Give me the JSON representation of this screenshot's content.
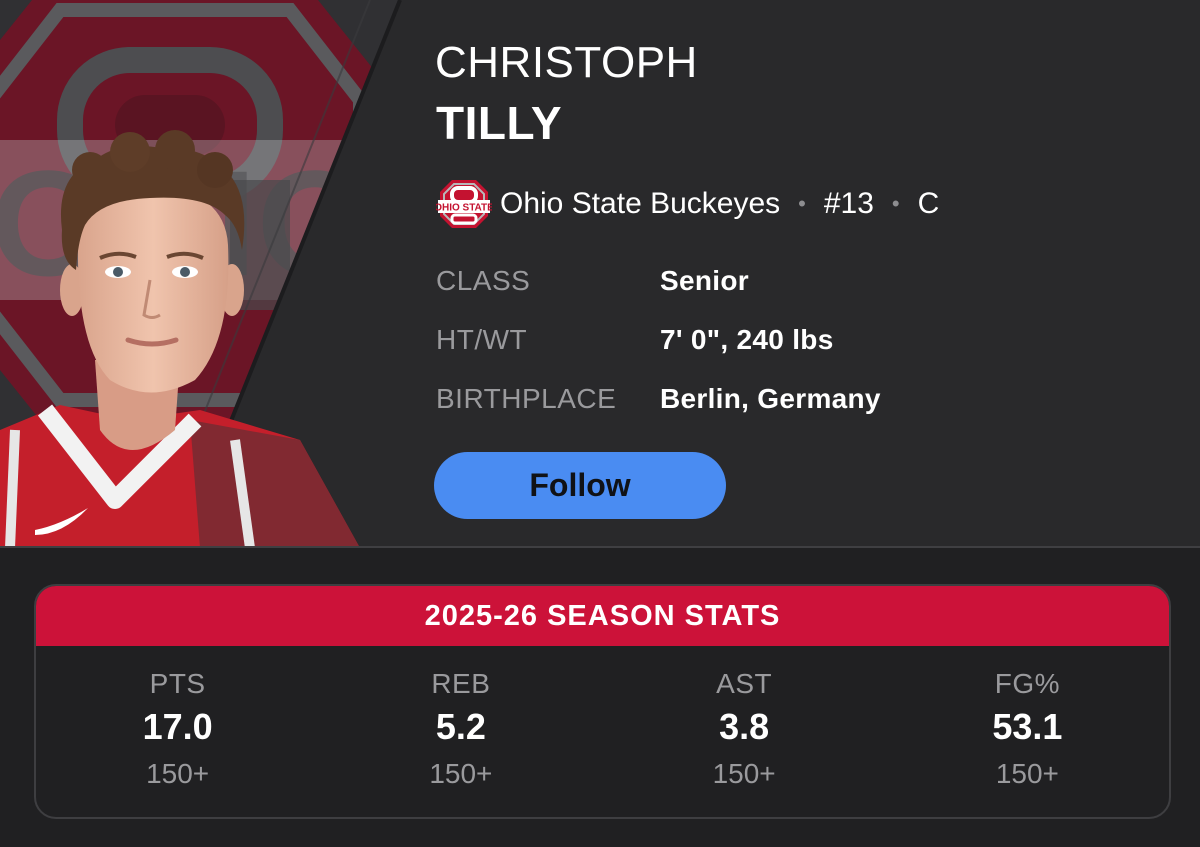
{
  "player": {
    "first_name": "CHRISTOPH",
    "last_name": "TILLY",
    "team": "Ohio State Buckeyes",
    "separator": "•",
    "number": "#13",
    "position": "C"
  },
  "bio": [
    {
      "label": "CLASS",
      "value": "Senior"
    },
    {
      "label": "HT/WT",
      "value": "7' 0\", 240 lbs"
    },
    {
      "label": "BIRTHPLACE",
      "value": "Berlin, Germany"
    }
  ],
  "follow_label": "Follow",
  "stats": {
    "title": "2025-26 SEASON STATS",
    "items": [
      {
        "label": "PTS",
        "value": "17.0",
        "rank": "150+"
      },
      {
        "label": "REB",
        "value": "5.2",
        "rank": "150+"
      },
      {
        "label": "AST",
        "value": "3.8",
        "rank": "150+"
      },
      {
        "label": "FG%",
        "value": "53.1",
        "rank": "150+"
      }
    ]
  },
  "logo": {
    "text": "OHIO STATE",
    "icon": "ohio-state-block-o-logo"
  },
  "colors": {
    "background": "#202022",
    "header": "#29292b",
    "accent_red": "#cc1239",
    "follow_blue": "#4a8cf2",
    "muted_text": "#9a9a9d"
  }
}
